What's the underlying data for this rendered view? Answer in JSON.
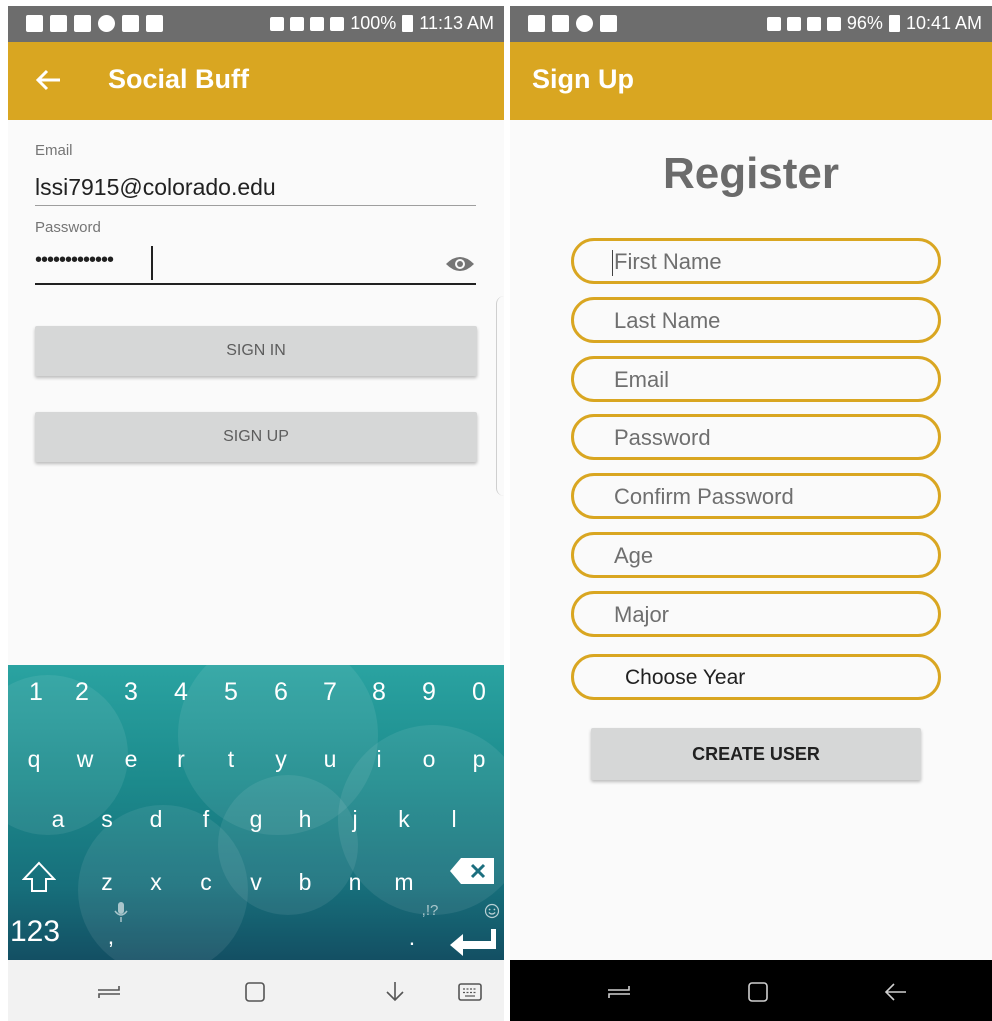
{
  "left_screen": {
    "status": {
      "battery": "100%",
      "time": "11:13 AM"
    },
    "appbar": {
      "title": "Social Buff"
    },
    "email": {
      "label": "Email",
      "value": "lssi7915@colorado.edu"
    },
    "password": {
      "label": "Password",
      "value": "•••••••••••••"
    },
    "buttons": {
      "sign_in": "SIGN IN",
      "sign_up": "SIGN UP"
    },
    "keyboard": {
      "numbers": [
        "1",
        "2",
        "3",
        "4",
        "5",
        "6",
        "7",
        "8",
        "9",
        "0"
      ],
      "row1": [
        "q",
        "w",
        "e",
        "r",
        "t",
        "y",
        "u",
        "i",
        "o",
        "p"
      ],
      "row2": [
        "a",
        "s",
        "d",
        "f",
        "g",
        "h",
        "j",
        "k",
        "l"
      ],
      "row3": [
        "z",
        "x",
        "c",
        "v",
        "b",
        "n",
        "m"
      ],
      "mode_key": "123",
      "comma": ",",
      "period": ".",
      "punct": ",!?"
    }
  },
  "right_screen": {
    "status": {
      "battery": "96%",
      "time": "10:41 AM"
    },
    "appbar": {
      "title": "Sign Up"
    },
    "heading": "Register",
    "fields": [
      {
        "placeholder": "First Name"
      },
      {
        "placeholder": "Last Name"
      },
      {
        "placeholder": "Email"
      },
      {
        "placeholder": "Password"
      },
      {
        "placeholder": "Confirm Password"
      },
      {
        "placeholder": "Age"
      },
      {
        "placeholder": "Major"
      }
    ],
    "year_select": {
      "value": "Choose Year"
    },
    "create_button": "CREATE USER"
  },
  "colors": {
    "accent": "#d9a621",
    "status_bar": "#6d6d6d",
    "keyboard_top": "#2aa3a1",
    "keyboard_bottom": "#134f63",
    "button_bg": "#d6d7d7"
  }
}
